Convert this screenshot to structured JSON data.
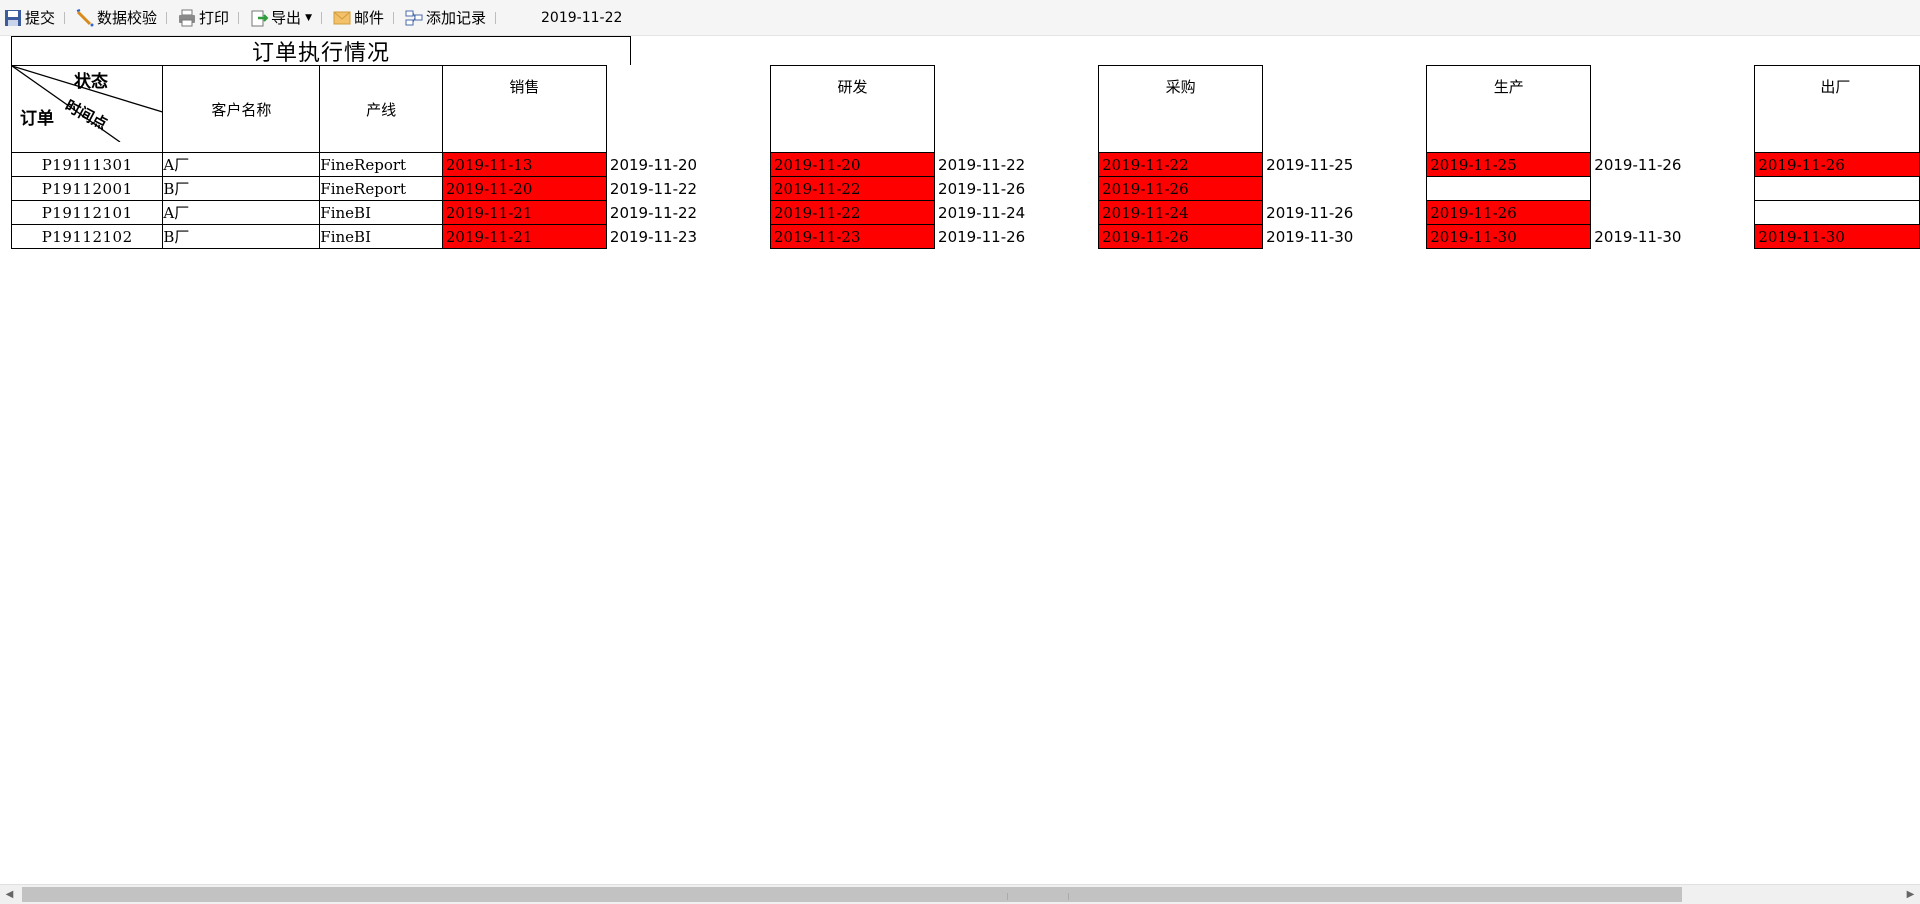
{
  "toolbar": {
    "submit": "提交",
    "validate": "数据校验",
    "print": "打印",
    "export": "导出",
    "mail": "邮件",
    "add_record": "添加记录",
    "date": "2019-11-22"
  },
  "report": {
    "title": "订单执行情况",
    "header": {
      "status": "状态",
      "time_point": "时间点",
      "order": "订单",
      "customer": "客户名称",
      "line": "产线",
      "stages": [
        "销售",
        "研发",
        "采购",
        "生产",
        "出厂"
      ]
    },
    "rows": [
      {
        "order": "P19111301",
        "customer": "A厂",
        "line": "FineReport",
        "stages": [
          {
            "plan": "2019-11-13",
            "actual": "2019-11-20"
          },
          {
            "plan": "2019-11-20",
            "actual": "2019-11-22"
          },
          {
            "plan": "2019-11-22",
            "actual": "2019-11-25"
          },
          {
            "plan": "2019-11-25",
            "actual": "2019-11-26"
          },
          {
            "plan": "2019-11-26",
            "actual": ""
          }
        ]
      },
      {
        "order": "P19112001",
        "customer": "B厂",
        "line": "FineReport",
        "stages": [
          {
            "plan": "2019-11-20",
            "actual": "2019-11-22"
          },
          {
            "plan": "2019-11-22",
            "actual": "2019-11-26"
          },
          {
            "plan": "2019-11-26",
            "actual": ""
          },
          {
            "plan": "",
            "actual": ""
          },
          {
            "plan": "",
            "actual": ""
          }
        ]
      },
      {
        "order": "P19112101",
        "customer": "A厂",
        "line": "FineBI",
        "stages": [
          {
            "plan": "2019-11-21",
            "actual": "2019-11-22"
          },
          {
            "plan": "2019-11-22",
            "actual": "2019-11-24"
          },
          {
            "plan": "2019-11-24",
            "actual": "2019-11-26"
          },
          {
            "plan": "2019-11-26",
            "actual": ""
          },
          {
            "plan": "",
            "actual": ""
          }
        ]
      },
      {
        "order": "P19112102",
        "customer": "B厂",
        "line": "FineBI",
        "stages": [
          {
            "plan": "2019-11-21",
            "actual": "2019-11-23"
          },
          {
            "plan": "2019-11-23",
            "actual": "2019-11-26"
          },
          {
            "plan": "2019-11-26",
            "actual": "2019-11-30"
          },
          {
            "plan": "2019-11-30",
            "actual": "2019-11-30"
          },
          {
            "plan": "2019-11-30",
            "actual": ""
          }
        ]
      }
    ],
    "colors": {
      "overdue": "#ff0000",
      "grid": "#000000"
    }
  }
}
